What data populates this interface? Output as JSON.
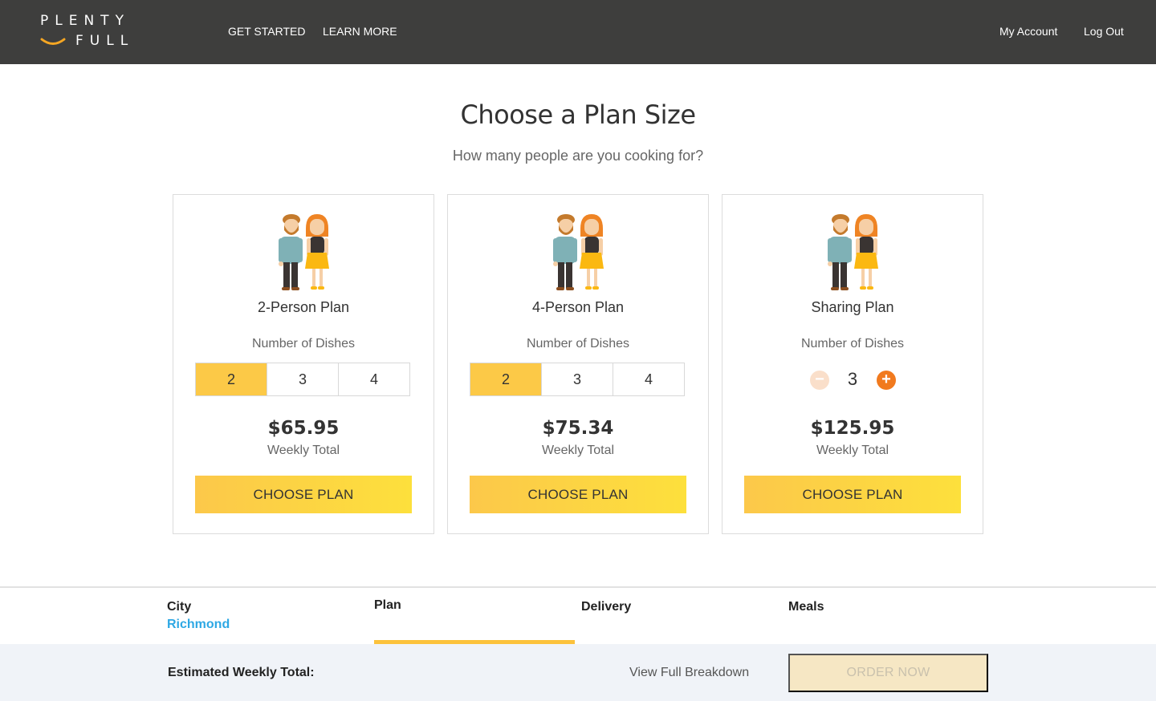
{
  "header": {
    "logo_top": "PLENTY",
    "logo_bottom": "FULL",
    "nav": [
      "GET STARTED",
      "LEARN MORE"
    ],
    "account": "My Account",
    "logout": "Log Out"
  },
  "hero": {
    "title": "Choose a Plan Size",
    "subtitle": "How many people are you cooking for?"
  },
  "plans": [
    {
      "name": "2-Person Plan",
      "dishes_label": "Number of Dishes",
      "options": [
        "2",
        "3",
        "4"
      ],
      "selected": "2",
      "price": "$65.95",
      "price_label": "Weekly Total",
      "cta": "CHOOSE PLAN"
    },
    {
      "name": "4-Person Plan",
      "dishes_label": "Number of Dishes",
      "options": [
        "2",
        "3",
        "4"
      ],
      "selected": "2",
      "price": "$75.34",
      "price_label": "Weekly Total",
      "cta": "CHOOSE PLAN"
    },
    {
      "name": "Sharing Plan",
      "dishes_label": "Number of Dishes",
      "stepper_value": "3",
      "price": "$125.95",
      "price_label": "Weekly Total",
      "cta": "CHOOSE PLAN"
    }
  ],
  "steps": {
    "city_label": "City",
    "city_value": "Richmond",
    "plan_label": "Plan",
    "delivery_label": "Delivery",
    "meals_label": "Meals"
  },
  "footer": {
    "estimate_label": "Estimated Weekly Total:",
    "breakdown": "View Full Breakdown",
    "order": "ORDER NOW"
  },
  "colors": {
    "header_bg": "#3e3e3d",
    "accent_yellow": "#fcc947",
    "accent_orange": "#f17a1e",
    "link_blue": "#2ea8e4",
    "footer_bg": "#f0f3f8"
  }
}
